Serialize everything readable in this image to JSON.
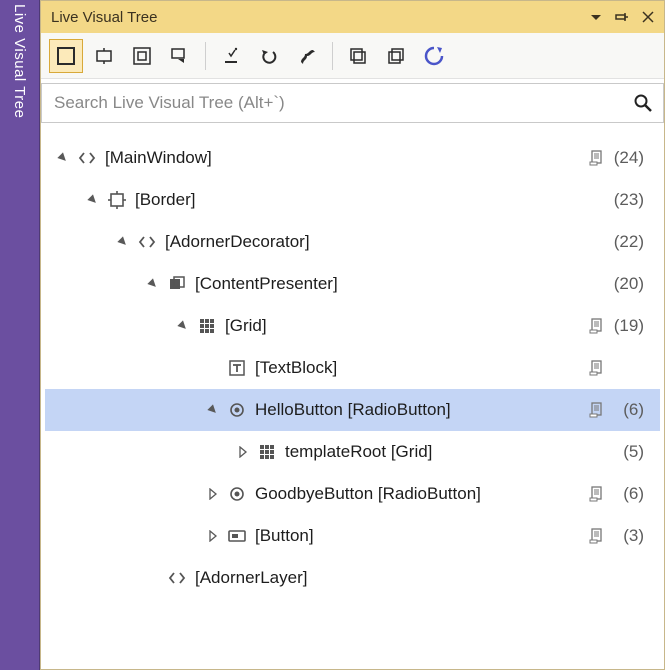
{
  "side_tab": {
    "label": "Live Visual Tree"
  },
  "titlebar": {
    "title": "Live Visual Tree"
  },
  "search": {
    "placeholder": "Search Live Visual Tree (Alt+`)"
  },
  "tree": [
    {
      "indent": 0,
      "exp": "open",
      "icon": "angle",
      "label": "[MainWindow]",
      "doc": true,
      "count": "(24)"
    },
    {
      "indent": 1,
      "exp": "open",
      "icon": "border",
      "label": "[Border]",
      "doc": false,
      "count": "(23)"
    },
    {
      "indent": 2,
      "exp": "open",
      "icon": "angle",
      "label": "[AdornerDecorator]",
      "doc": false,
      "count": "(22)"
    },
    {
      "indent": 3,
      "exp": "open",
      "icon": "presenter",
      "label": "[ContentPresenter]",
      "doc": false,
      "count": "(20)"
    },
    {
      "indent": 4,
      "exp": "open",
      "icon": "grid",
      "label": "[Grid]",
      "doc": true,
      "count": "(19)"
    },
    {
      "indent": 5,
      "exp": "none",
      "icon": "textblock",
      "label": "[TextBlock]",
      "doc": true,
      "count": ""
    },
    {
      "indent": 5,
      "exp": "open",
      "icon": "radio",
      "label": "HelloButton [RadioButton]",
      "doc": true,
      "count": "(6)",
      "selected": true
    },
    {
      "indent": 6,
      "exp": "closed",
      "icon": "grid",
      "label": "templateRoot [Grid]",
      "doc": false,
      "count": "(5)"
    },
    {
      "indent": 5,
      "exp": "closed",
      "icon": "radio",
      "label": "GoodbyeButton [RadioButton]",
      "doc": true,
      "count": "(6)"
    },
    {
      "indent": 5,
      "exp": "closed",
      "icon": "button",
      "label": "[Button]",
      "doc": true,
      "count": "(3)"
    },
    {
      "indent": 3,
      "exp": "none",
      "icon": "angle",
      "label": "[AdornerLayer]",
      "doc": false,
      "count": ""
    }
  ]
}
